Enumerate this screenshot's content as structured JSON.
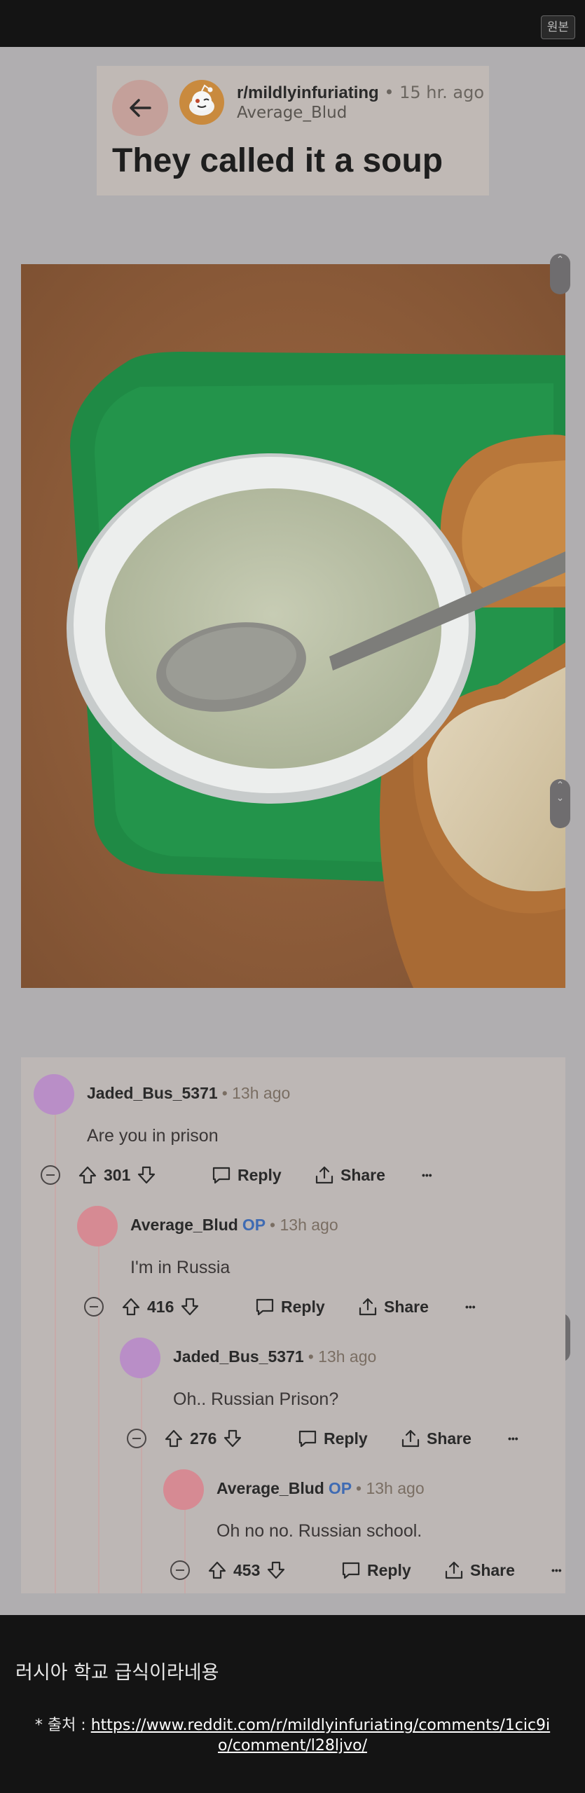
{
  "toolbar": {
    "original_label": "원본"
  },
  "post": {
    "subreddit": "r/mildlyinfuriating",
    "separator": "•",
    "time_ago": "15 hr. ago",
    "author": "Average_Blud",
    "title": "They called it a soup"
  },
  "comments": [
    {
      "user": "Jaded_Bus_5371",
      "op": "",
      "time_ago": "13h ago",
      "body": "Are you in prison",
      "votes": "301",
      "avatar_color": "#b98ec7"
    },
    {
      "user": "Average_Blud",
      "op": "OP",
      "time_ago": "13h ago",
      "body": "I'm in Russia",
      "votes": "416",
      "avatar_color": "#d68a93"
    },
    {
      "user": "Jaded_Bus_5371",
      "op": "",
      "time_ago": "13h ago",
      "body": "Oh.. Russian Prison?",
      "votes": "276",
      "avatar_color": "#b98ec7"
    },
    {
      "user": "Average_Blud",
      "op": "OP",
      "time_ago": "13h ago",
      "body": "Oh no no. Russian school.",
      "votes": "453",
      "avatar_color": "#d68a93"
    }
  ],
  "actions": {
    "reply": "Reply",
    "share": "Share",
    "more": "•••"
  },
  "footer": {
    "caption": "러시아 학교 급식이라네용",
    "source_prefix": "* 출처 : ",
    "source_url": "https://www.reddit.com/r/mildlyinfuriating/comments/1cic9io/comment/l28ljvo/"
  },
  "colors": {
    "op_badge": "#3f6bb3",
    "tray": "#1f8a45",
    "table": "#8a5d3b"
  }
}
